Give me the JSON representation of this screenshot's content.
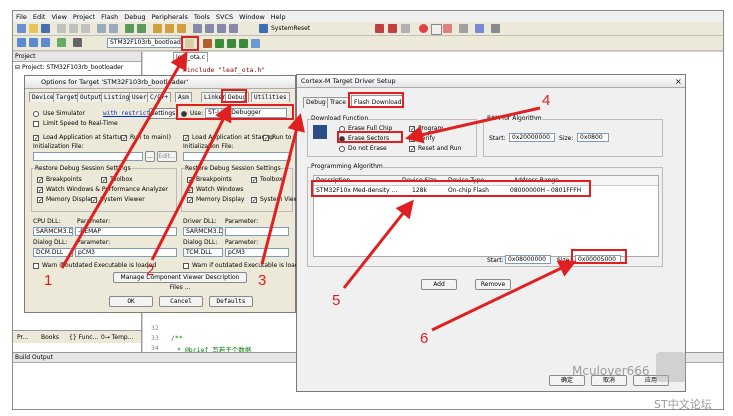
{
  "menu": [
    "File",
    "Edit",
    "View",
    "Project",
    "Flash",
    "Debug",
    "Peripherals",
    "Tools",
    "SVCS",
    "Window",
    "Help"
  ],
  "toolbar": {
    "target_combo": "STM32F103rb_bootload",
    "system_reset": "SystemReset"
  },
  "project_panel": {
    "title": "Project",
    "root": "Project: STM32F103rb_bootloader",
    "bottom_tabs": [
      "Pr...",
      "Books",
      "{} Func...",
      "0→ Temp..."
    ]
  },
  "editor": {
    "tab": "leaf_ota.c",
    "include_line": "#include \"leaf_ota.h\"",
    "line_numbers": [
      "32",
      "33",
      "34"
    ],
    "comment_open": "/**",
    "comment_line": "* @brief  写若干个数据"
  },
  "build_output": {
    "title": "Build Output"
  },
  "options_dialog": {
    "title": "Options for Target 'STM32F103rb_bootloader'",
    "tabs": [
      "Device",
      "Target",
      "Output",
      "Listing",
      "User",
      "C/C++",
      "Asm",
      "Linker",
      "Debug",
      "Utilities"
    ],
    "use_simulator": "Use Simulator",
    "with_restrictions": "with restrictions",
    "settings": "Settings",
    "limit_speed": "Limit Speed to Real-Time",
    "load_app": "Load Application at Startup",
    "run_to_main": "Run to main()",
    "init_file": "Initialization File:",
    "edit": "Edit...",
    "restore_title": "Restore Debug Session Settings",
    "breakpoints": "Breakpoints",
    "toolbox": "Toolbox",
    "watch_windows": "Watch Windows & Performance Analyzer",
    "watch_windows_short": "Watch Windows",
    "memory_display": "Memory Display",
    "system_viewer": "System Viewer",
    "cpu_dll": "CPU DLL:",
    "parameter": "Parameter:",
    "cpu_dll_val": "SARMCM3.DLL",
    "cpu_param_val": "-REMAP",
    "dialog_dll": "Dialog DLL:",
    "dialog_dll_val": "DCM.DLL",
    "dialog_param_val": "pCM3",
    "warn_outdated": "Warn if outdated Executable is loaded",
    "use": "Use:",
    "debugger": "ST-Link Debugger",
    "run_to_short": "Run to",
    "driver_dll": "Driver DLL:",
    "driver_dll_val": "SARMCM3.DLL",
    "tcm_dll_val": "TCM.DLL",
    "manage_btn": "Manage Component Viewer Description Files ...",
    "ok": "OK",
    "cancel": "Cancel",
    "defaults": "Defaults"
  },
  "cortex_dialog": {
    "title": "Cortex-M Target Driver Setup",
    "tabs": [
      "Debug",
      "Trace",
      "Flash Download"
    ],
    "download_function": "Download Function",
    "erase_full": "Erase Full Chip",
    "erase_sectors": "Erase Sectors",
    "do_not_erase": "Do not Erase",
    "program": "Program",
    "verify": "Verify",
    "reset_run": "Reset and Run",
    "ram_algo": "RAM for Algorithm",
    "start": "Start:",
    "ram_start": "0x20000000",
    "size": "Size:",
    "ram_size": "0x0800",
    "prog_algo": "Programming Algorithm",
    "columns": [
      "Description",
      "Device Size",
      "Device Type",
      "Address Range"
    ],
    "row": [
      "STM32F10x Med-density ...",
      "128k",
      "On-chip Flash",
      "08000000H - 0801FFFH"
    ],
    "algo_start": "0x08000000",
    "algo_size": "0x00005000",
    "add": "Add",
    "remove": "Remove",
    "ok": "确定",
    "cancel": "取消",
    "apply": "应用"
  },
  "callouts": [
    "1",
    "2",
    "3",
    "4",
    "5",
    "6"
  ],
  "watermark": {
    "wechat": "Mculover666",
    "site": "ST中文论坛"
  },
  "colors": {
    "accent_red": "#e02020",
    "selection": "#3399ff"
  }
}
